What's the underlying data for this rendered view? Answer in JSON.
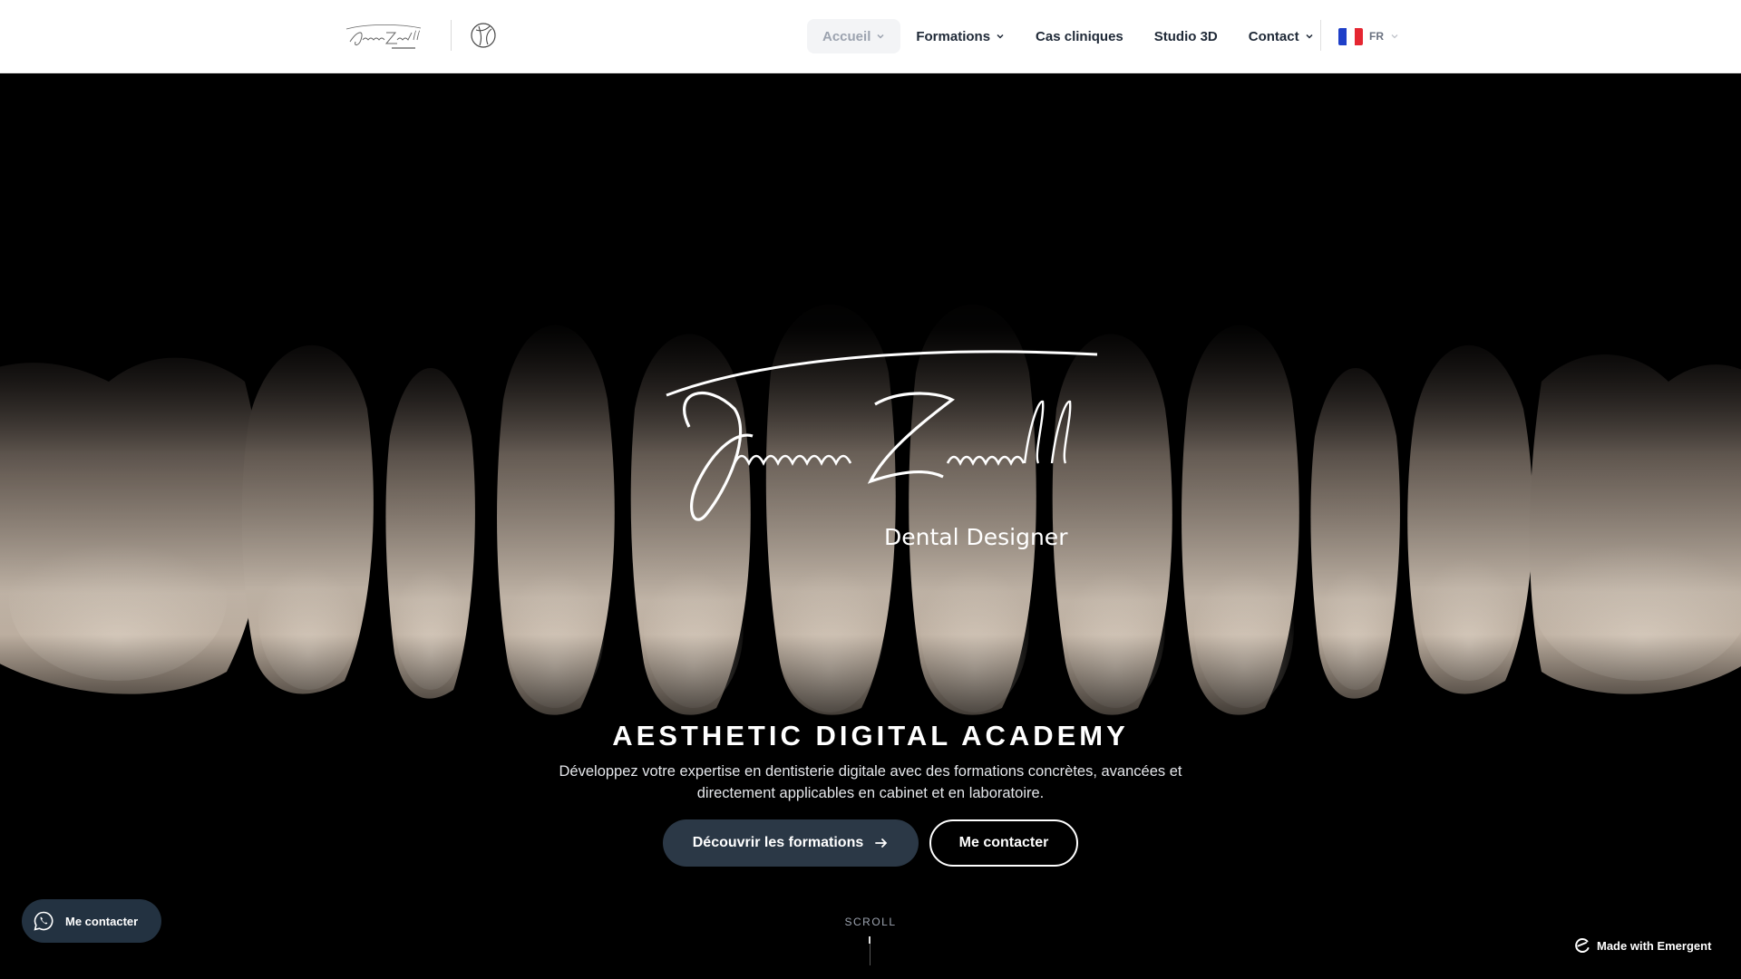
{
  "header": {
    "nav": [
      {
        "label": "Accueil",
        "has_dropdown": true,
        "active": true
      },
      {
        "label": "Formations",
        "has_dropdown": true
      },
      {
        "label": "Cas cliniques",
        "has_dropdown": false
      },
      {
        "label": "Studio 3D",
        "has_dropdown": false
      },
      {
        "label": "Contact",
        "has_dropdown": true
      }
    ],
    "language": {
      "code": "FR",
      "flag": "france-flag-icon"
    }
  },
  "hero": {
    "signature_name": "Francesco Zammillo",
    "signature_tagline": "Dental Designer",
    "title": "AESTHETIC DIGITAL ACADEMY",
    "subtitle": "Développez votre expertise en dentisterie digitale avec des formations concrètes, avancées et directement applicables en cabinet et en laboratoire.",
    "primary_button": "Découvrir les formations",
    "secondary_button": "Me contacter",
    "scroll_label": "SCROLL"
  },
  "whatsapp_button": {
    "label": "Me contacter",
    "icon": "whatsapp-icon"
  },
  "badge": {
    "label": "Made with Emergent",
    "icon": "emergent-logo-icon"
  },
  "colors": {
    "primary_button_bg": "#2b3846",
    "whatsapp_bg": "#233241",
    "hero_bg": "#000000",
    "nav_text": "#1f2937"
  }
}
